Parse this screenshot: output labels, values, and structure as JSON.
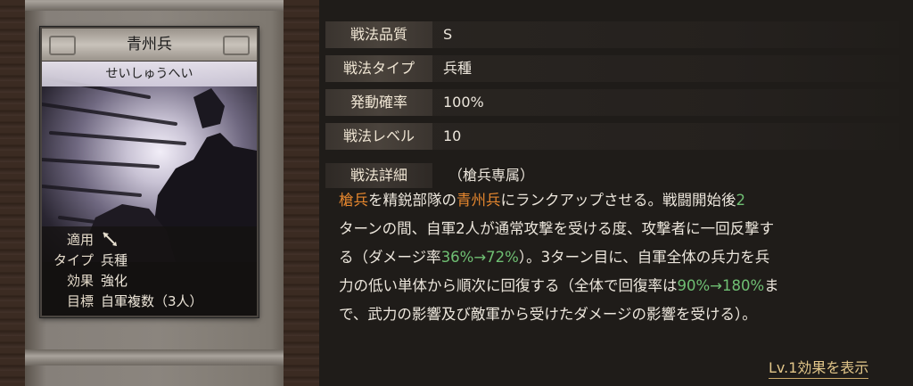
{
  "card": {
    "name": "青州兵",
    "reading": "せいしゅうへい",
    "info": [
      {
        "label": "適用",
        "value": "",
        "icon": "spear-icon"
      },
      {
        "label": "タイプ",
        "value": "兵種"
      },
      {
        "label": "効果",
        "value": "強化"
      },
      {
        "label": "目標",
        "value": "自軍複数（3人）"
      }
    ]
  },
  "stats": [
    {
      "label": "戦法品質",
      "value": "S"
    },
    {
      "label": "戦法タイプ",
      "value": "兵種"
    },
    {
      "label": "発動確率",
      "value": "100%"
    },
    {
      "label": "戦法レベル",
      "value": "10"
    }
  ],
  "detail": {
    "label": "戦法詳細",
    "note": "（槍兵専属）",
    "lines": [
      [
        {
          "t": "槍兵",
          "c": "orange"
        },
        {
          "t": "を精鋭部隊の"
        },
        {
          "t": "青州兵",
          "c": "orange"
        },
        {
          "t": "にランクアップさせる。戦闘開始後"
        },
        {
          "t": "2",
          "c": "green"
        }
      ],
      [
        {
          "t": "ターンの間、自軍2人が通常攻撃を受ける度、攻撃者に一回反撃す"
        }
      ],
      [
        {
          "t": "る（ダメージ率"
        },
        {
          "t": "36%→72%",
          "c": "green"
        },
        {
          "t": "）。3ターン目に、自軍全体の兵力を兵"
        }
      ],
      [
        {
          "t": "力の低い単体から順次に回復する（全体で回復率は"
        },
        {
          "t": "90%→180%",
          "c": "green"
        },
        {
          "t": "ま"
        }
      ],
      [
        {
          "t": "で、武力の影響及び敵軍から受けたダメージの影響を受ける）。"
        }
      ]
    ]
  },
  "link_label": "Lv.1効果を表示",
  "colors": {
    "accent_orange": "#e4862e",
    "accent_green": "#6fbf73",
    "link_gold": "#e3c78a"
  }
}
